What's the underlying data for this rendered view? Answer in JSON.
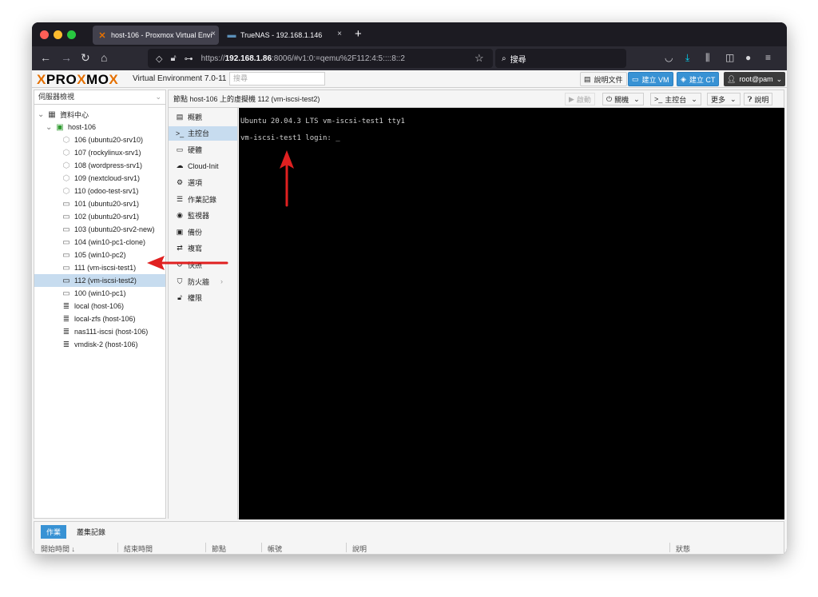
{
  "browser": {
    "tabs": [
      {
        "title": "host-106 - Proxmox Virtual Envi",
        "active": true,
        "icon": "proxmox-x-icon"
      },
      {
        "title": "TrueNAS - 192.168.1.146",
        "active": false,
        "icon": "truenas-icon"
      }
    ],
    "new_tab": "+",
    "close_glyph": "×",
    "url_prefix": "https://",
    "url_host": "192.168.1.86",
    "url_rest": ":8006/#v1:0:=qemu%2F112:4:5::::8::2",
    "search_placeholder": "搜尋"
  },
  "proxmox": {
    "logo_left": "PRO",
    "logo_x": "X",
    "logo_mid": "MO",
    "logo_x2": "X",
    "version": "Virtual Environment 7.0-11",
    "search_placeholder": "搜尋",
    "buttons": {
      "docs": "說明文件",
      "create_vm": "建立 VM",
      "create_ct": "建立 CT",
      "user": "root@pam"
    },
    "view_selector": "伺服器檢視",
    "tree": {
      "datacenter": "資料中心",
      "node": "host-106",
      "items": [
        {
          "label": "106 (ubuntu20-srv10)",
          "kind": "vm-off"
        },
        {
          "label": "107 (rockylinux-srv1)",
          "kind": "vm-off"
        },
        {
          "label": "108 (wordpress-srv1)",
          "kind": "vm-off"
        },
        {
          "label": "109 (nextcloud-srv1)",
          "kind": "vm-off"
        },
        {
          "label": "110 (odoo-test-srv1)",
          "kind": "vm-off"
        },
        {
          "label": "101 (ubuntu20-srv1)",
          "kind": "vm-monitor"
        },
        {
          "label": "102 (ubuntu20-srv1)",
          "kind": "vm-monitor"
        },
        {
          "label": "103 (ubuntu20-srv2-new)",
          "kind": "vm-monitor"
        },
        {
          "label": "104 (win10-pc1-clone)",
          "kind": "vm-monitor"
        },
        {
          "label": "105 (win10-pc2)",
          "kind": "vm-monitor"
        },
        {
          "label": "111 (vm-iscsi-test1)",
          "kind": "vm-monitor"
        },
        {
          "label": "112 (vm-iscsi-test2)",
          "kind": "vm-running",
          "selected": true
        },
        {
          "label": "100 (win10-pc1)",
          "kind": "vm-monitor"
        },
        {
          "label": "local (host-106)",
          "kind": "storage"
        },
        {
          "label": "local-zfs (host-106)",
          "kind": "storage"
        },
        {
          "label": "nas111-iscsi (host-106)",
          "kind": "storage"
        },
        {
          "label": "vmdisk-2 (host-106)",
          "kind": "storage"
        }
      ]
    },
    "vm_title": "節點 host-106 上的虛擬機 112 (vm-iscsi-test2)",
    "toolbar": {
      "start": "啟動",
      "shutdown": "關機",
      "console": "主控台",
      "more": "更多",
      "help": "說明"
    },
    "menu": [
      {
        "label": "概觀",
        "icon": "book-icon"
      },
      {
        "label": "主控台",
        "icon": "terminal-icon",
        "selected": true
      },
      {
        "label": "硬體",
        "icon": "desktop-icon"
      },
      {
        "label": "Cloud-Init",
        "icon": "cloud-icon"
      },
      {
        "label": "選項",
        "icon": "gear-icon"
      },
      {
        "label": "作業記錄",
        "icon": "list-icon"
      },
      {
        "label": "監視器",
        "icon": "eye-icon"
      },
      {
        "label": "備份",
        "icon": "floppy-icon"
      },
      {
        "label": "複寫",
        "icon": "retweet-icon"
      },
      {
        "label": "快照",
        "icon": "history-icon"
      },
      {
        "label": "防火牆",
        "icon": "shield-icon",
        "has_submenu": true
      },
      {
        "label": "權限",
        "icon": "unlock-icon"
      }
    ],
    "console": {
      "line1": "Ubuntu 20.04.3 LTS vm-iscsi-test1 tty1",
      "line2": "vm-iscsi-test1 login: _"
    },
    "bottom": {
      "tabs": [
        "作業",
        "叢集記錄"
      ],
      "columns": [
        "開始時間 ↓",
        "結束時間",
        "節點",
        "帳號",
        "說明",
        "狀態"
      ]
    }
  },
  "colors": {
    "accent_blue": "#3892d4",
    "proxmox_orange": "#e57000",
    "annotation_red": "#e02020",
    "selected_row": "#c7dcef"
  }
}
